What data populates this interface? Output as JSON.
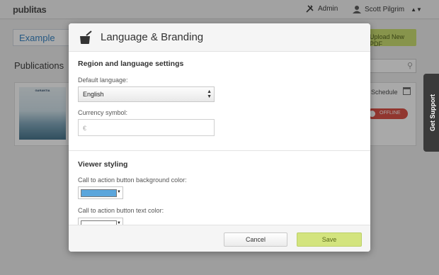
{
  "app": {
    "logo_text": "publitas",
    "admin_label": "Admin",
    "user_name": "Scott Pilgrim",
    "example_tab": "Example",
    "upload_label": "Upload New PDF",
    "publications_heading": "Publications",
    "schedule_label": "Schedule",
    "offline_label": "OFFLINE",
    "thumb_title": "GARANTIA",
    "support_label": "Get Support"
  },
  "modal": {
    "title": "Language & Branding",
    "region_section": "Region and language settings",
    "default_language_label": "Default language:",
    "default_language_value": "English",
    "currency_label": "Currency symbol:",
    "currency_placeholder": "€",
    "viewer_section": "Viewer styling",
    "cta_bg_label": "Call to action button background color:",
    "cta_bg_color": "#5ba6dc",
    "cta_text_label": "Call to action button text color:",
    "cta_text_color": "#ffffff",
    "cancel_label": "Cancel",
    "save_label": "Save"
  },
  "icons": {
    "admin": "tools-icon",
    "user": "user-icon",
    "search": "search-icon",
    "calendar": "calendar-icon",
    "modal": "paint-bucket-icon"
  },
  "colors": {
    "accent_green": "#d3e47e",
    "accent_blue": "#2d7fc2",
    "offline_red": "#d9463b"
  }
}
